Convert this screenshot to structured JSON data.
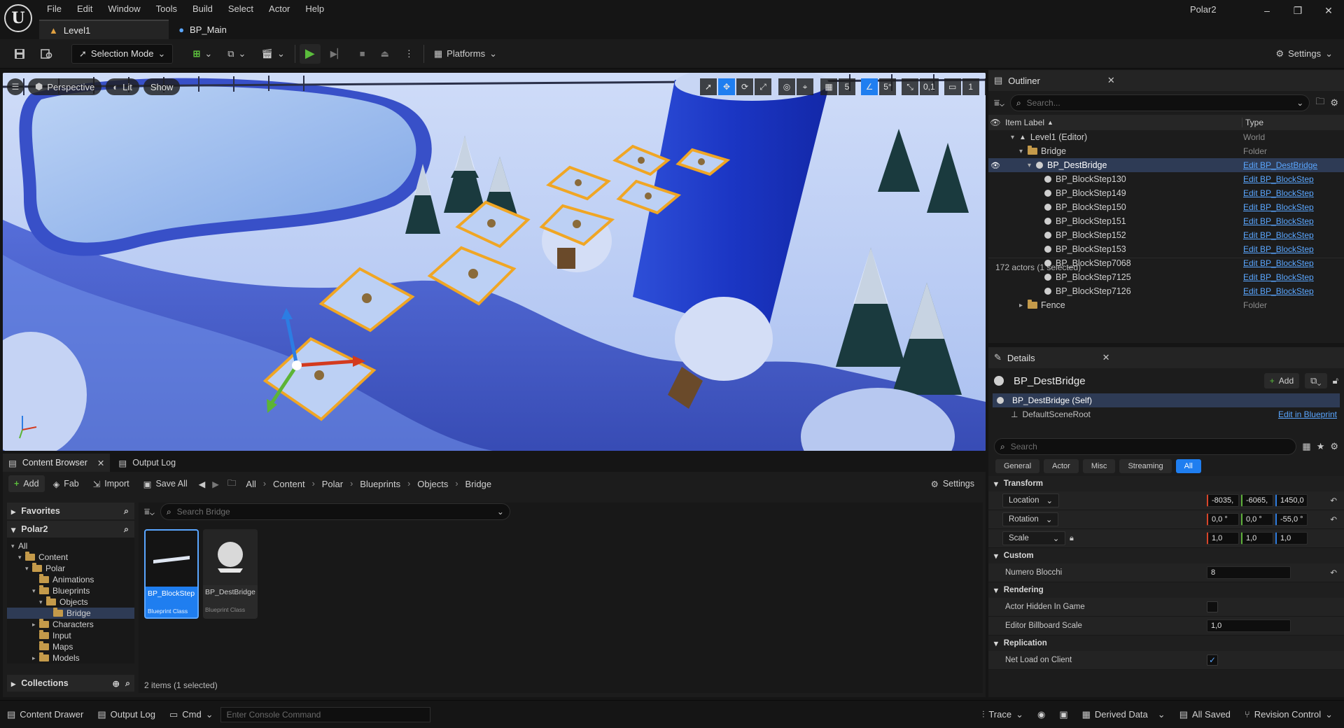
{
  "app": {
    "logo": "U",
    "project_name": "Polar2",
    "menus": [
      "File",
      "Edit",
      "Window",
      "Tools",
      "Build",
      "Select",
      "Actor",
      "Help"
    ],
    "doc_tabs": [
      {
        "label": "Level1",
        "icon": "level-icon"
      },
      {
        "label": "BP_Main",
        "icon": "person-icon"
      }
    ],
    "window_controls": {
      "minimize": "–",
      "restore": "❐",
      "close": "✕"
    }
  },
  "toolbar": {
    "selection_mode": "Selection Mode",
    "platforms": "Platforms",
    "settings": "Settings"
  },
  "viewport": {
    "perspective": "Perspective",
    "lit": "Lit",
    "show": "Show",
    "grid_value": "5",
    "angle_value": "5°",
    "scale_value": "0,1",
    "camera_speed": "1"
  },
  "outliner": {
    "tab_title": "Outliner",
    "search_placeholder": "Search...",
    "col_label": "Item Label",
    "col_type": "Type",
    "rows": [
      {
        "label": "Level1 (Editor)",
        "type": "World",
        "indent": 1,
        "kind": "world",
        "link": false,
        "sel": false
      },
      {
        "label": "Bridge",
        "type": "Folder",
        "indent": 2,
        "kind": "folder",
        "link": false,
        "sel": false
      },
      {
        "label": "BP_DestBridge",
        "type": "Edit BP_DestBridge",
        "indent": 3,
        "kind": "actor",
        "link": true,
        "sel": true
      },
      {
        "label": "BP_BlockStep130",
        "type": "Edit BP_BlockStep",
        "indent": 4,
        "kind": "actor",
        "link": true,
        "sel": false
      },
      {
        "label": "BP_BlockStep149",
        "type": "Edit BP_BlockStep",
        "indent": 4,
        "kind": "actor",
        "link": true,
        "sel": false
      },
      {
        "label": "BP_BlockStep150",
        "type": "Edit BP_BlockStep",
        "indent": 4,
        "kind": "actor",
        "link": true,
        "sel": false
      },
      {
        "label": "BP_BlockStep151",
        "type": "Edit BP_BlockStep",
        "indent": 4,
        "kind": "actor",
        "link": true,
        "sel": false
      },
      {
        "label": "BP_BlockStep152",
        "type": "Edit BP_BlockStep",
        "indent": 4,
        "kind": "actor",
        "link": true,
        "sel": false
      },
      {
        "label": "BP_BlockStep153",
        "type": "Edit BP_BlockStep",
        "indent": 4,
        "kind": "actor",
        "link": true,
        "sel": false
      },
      {
        "label": "BP_BlockStep7068",
        "type": "Edit BP_BlockStep",
        "indent": 4,
        "kind": "actor",
        "link": true,
        "sel": false
      },
      {
        "label": "BP_BlockStep7125",
        "type": "Edit BP_BlockStep",
        "indent": 4,
        "kind": "actor",
        "link": true,
        "sel": false
      },
      {
        "label": "BP_BlockStep7126",
        "type": "Edit BP_BlockStep",
        "indent": 4,
        "kind": "actor",
        "link": true,
        "sel": false
      },
      {
        "label": "Fence",
        "type": "Folder",
        "indent": 2,
        "kind": "folder",
        "link": false,
        "sel": false
      }
    ],
    "status": "172 actors (1 selected)"
  },
  "details": {
    "tab_title": "Details",
    "actor_name": "BP_DestBridge",
    "add_label": "Add",
    "component_self": "BP_DestBridge (Self)",
    "component_root": "DefaultSceneRoot",
    "edit_in_blueprint": "Edit in Blueprint",
    "search_placeholder": "Search",
    "filter_tabs": [
      "General",
      "Actor",
      "Misc",
      "Streaming",
      "All"
    ],
    "active_filter": "All",
    "transform_title": "Transform",
    "location_label": "Location",
    "location": [
      "-8035,",
      "-6065,",
      "1450,0"
    ],
    "rotation_label": "Rotation",
    "rotation": [
      "0,0 °",
      "0,0 °",
      "-55,0 °"
    ],
    "scale_label": "Scale",
    "scale": [
      "1,0",
      "1,0",
      "1,0"
    ],
    "custom_title": "Custom",
    "numero_blocchi_label": "Numero Blocchi",
    "numero_blocchi": "8",
    "rendering_title": "Rendering",
    "actor_hidden_label": "Actor Hidden In Game",
    "actor_hidden": false,
    "billboard_label": "Editor Billboard Scale",
    "billboard": "1,0",
    "replication_title": "Replication",
    "net_load_label": "Net Load on Client",
    "net_load": true
  },
  "content_browser": {
    "tab_title": "Content Browser",
    "output_tab": "Output Log",
    "add": "Add",
    "fab": "Fab",
    "import": "Import",
    "save_all": "Save All",
    "breadcrumbs": [
      "All",
      "Content",
      "Polar",
      "Blueprints",
      "Objects",
      "Bridge"
    ],
    "settings": "Settings",
    "favorites": "Favorites",
    "project": "Polar2",
    "search_placeholder": "Search Bridge",
    "tree": [
      {
        "label": "All",
        "indent": 0,
        "sel": false
      },
      {
        "label": "Content",
        "indent": 1,
        "sel": false
      },
      {
        "label": "Polar",
        "indent": 2,
        "sel": false
      },
      {
        "label": "Animations",
        "indent": 3,
        "sel": false
      },
      {
        "label": "Blueprints",
        "indent": 3,
        "sel": false
      },
      {
        "label": "Objects",
        "indent": 4,
        "sel": false
      },
      {
        "label": "Bridge",
        "indent": 5,
        "sel": true
      },
      {
        "label": "Characters",
        "indent": 3,
        "sel": false
      },
      {
        "label": "Input",
        "indent": 3,
        "sel": false
      },
      {
        "label": "Maps",
        "indent": 3,
        "sel": false
      },
      {
        "label": "Models",
        "indent": 3,
        "sel": false
      }
    ],
    "collections": "Collections",
    "assets": [
      {
        "name": "BP_BlockStep",
        "cls": "Blueprint Class"
      },
      {
        "name": "BP_DestBridge",
        "cls": "Blueprint Class"
      }
    ],
    "item_count": "2 items (1 selected)"
  },
  "statusbar": {
    "content_drawer": "Content Drawer",
    "output_log": "Output Log",
    "cmd": "Cmd",
    "console_placeholder": "Enter Console Command",
    "trace": "Trace",
    "derived_data": "Derived Data",
    "all_saved": "All Saved",
    "revision_control": "Revision Control"
  }
}
